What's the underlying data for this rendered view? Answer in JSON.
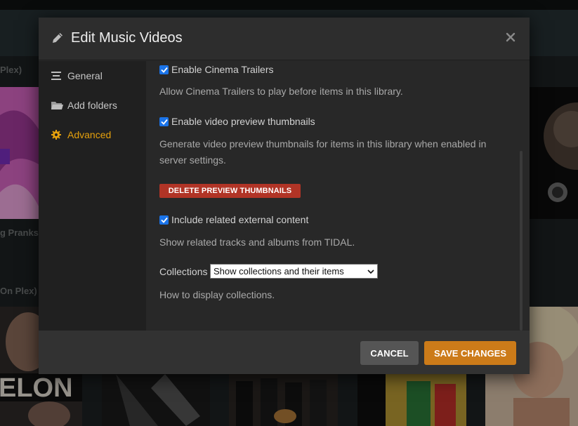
{
  "background": {
    "labels": [
      "Plex)",
      "g Pranks",
      "On Plex)"
    ],
    "posters": [
      {
        "name": "poster-1",
        "color": "#c04fb0"
      },
      {
        "name": "poster-2",
        "color": "#3a3a3a"
      },
      {
        "name": "poster-3",
        "color": "#b0b0b0"
      }
    ],
    "poster_text": "ELON"
  },
  "modal": {
    "title": "Edit Music Videos",
    "title_icon": "pencil-icon",
    "close_icon": "close-icon"
  },
  "sidebar": {
    "items": [
      {
        "label": "General",
        "icon": "list-icon"
      },
      {
        "label": "Add folders",
        "icon": "folder-icon"
      },
      {
        "label": "Advanced",
        "icon": "gear-icon",
        "active": true
      }
    ]
  },
  "settings": {
    "cinema_trailers": {
      "label": "Enable Cinema Trailers",
      "checked": true,
      "help": "Allow Cinema Trailers to play before items in this library."
    },
    "preview_thumbnails": {
      "label": "Enable video preview thumbnails",
      "checked": true,
      "help": "Generate video preview thumbnails for items in this library when enabled in server settings.",
      "delete_button": "DELETE PREVIEW THUMBNAILS"
    },
    "related_content": {
      "label": "Include related external content",
      "checked": true,
      "help": "Show related tracks and albums from TIDAL."
    },
    "collections": {
      "label": "Collections",
      "selected": "Show collections and their items",
      "help": "How to display collections."
    }
  },
  "footer": {
    "cancel_label": "CANCEL",
    "save_label": "SAVE CHANGES"
  },
  "colors": {
    "accent": "#e5a00d",
    "save": "#cc7b19",
    "danger": "#b13426",
    "checkbox": "#1a73e8"
  }
}
